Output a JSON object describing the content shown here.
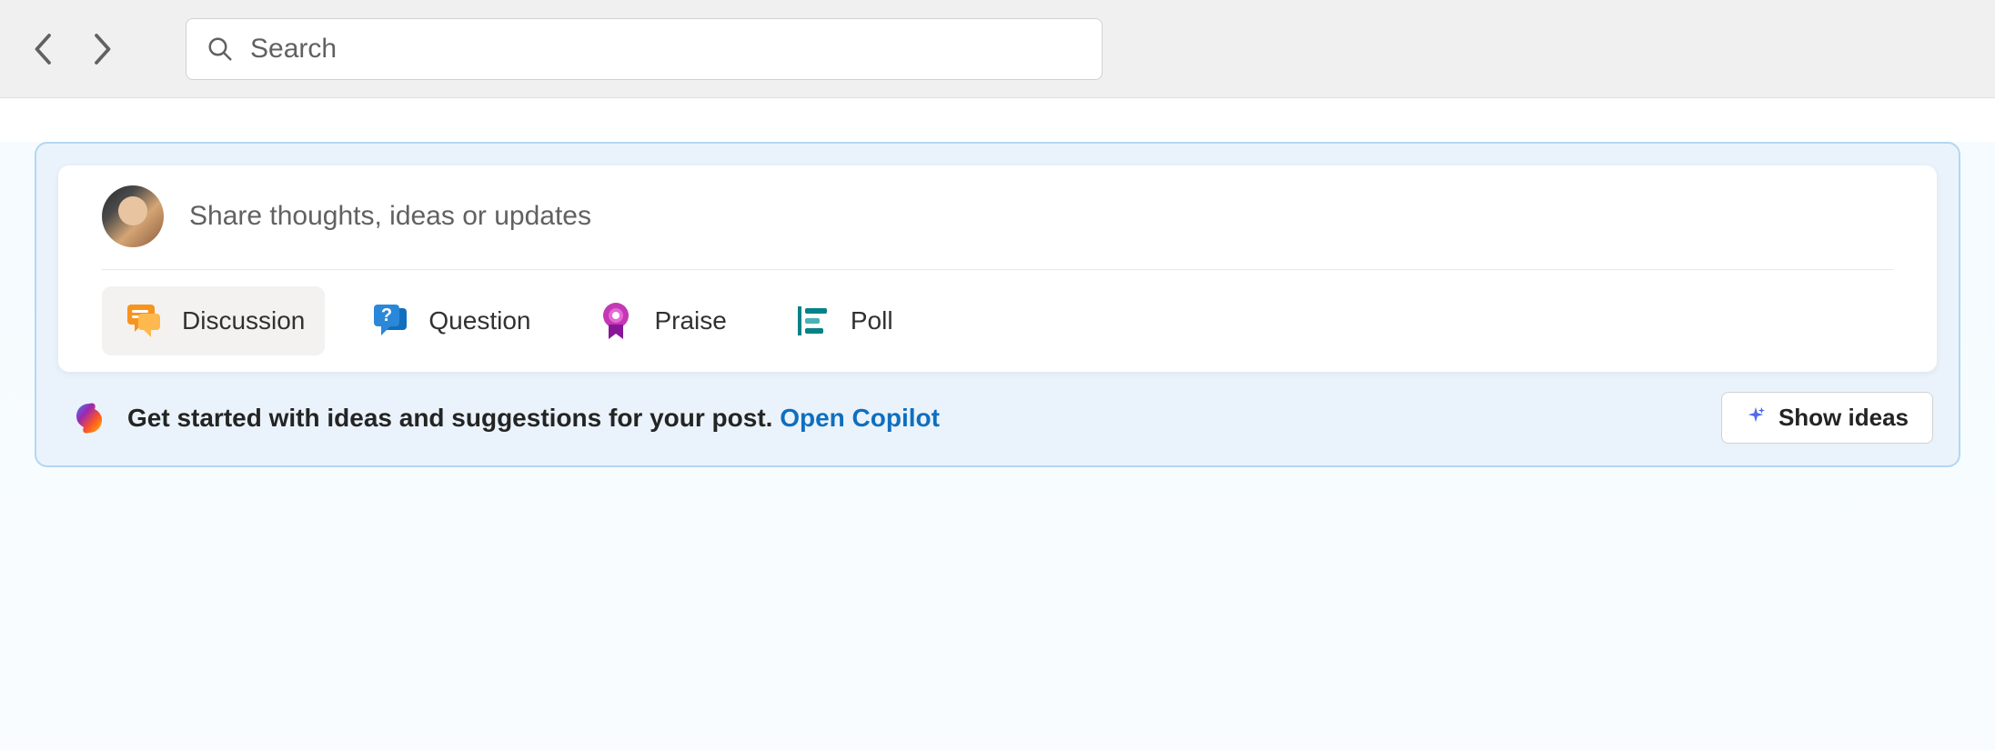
{
  "header": {
    "search_placeholder": "Search"
  },
  "composer": {
    "placeholder": "Share thoughts, ideas or updates",
    "post_types": [
      {
        "label": "Discussion",
        "icon": "discussion-icon",
        "active": true
      },
      {
        "label": "Question",
        "icon": "question-icon",
        "active": false
      },
      {
        "label": "Praise",
        "icon": "praise-icon",
        "active": false
      },
      {
        "label": "Poll",
        "icon": "poll-icon",
        "active": false
      }
    ]
  },
  "copilot": {
    "message": "Get started with ideas and suggestions for your post. ",
    "link_text": "Open Copilot",
    "button_label": "Show ideas"
  }
}
